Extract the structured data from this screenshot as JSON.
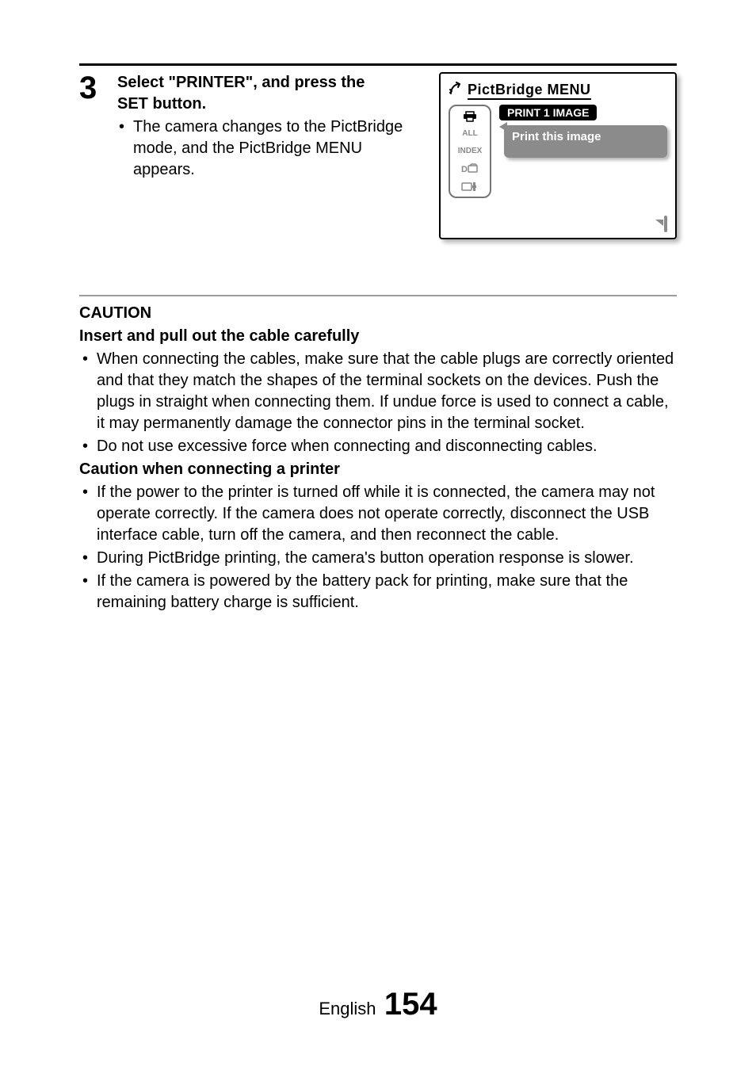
{
  "step": {
    "number": "3",
    "title_line1": "Select \"PRINTER\", and press the",
    "title_line2": "SET button.",
    "sub": "The camera changes to the PictBridge mode, and the PictBridge MENU appears."
  },
  "screen": {
    "title": "PictBridge MENU",
    "menu_highlight": "PRINT 1 IMAGE",
    "menu_note": "Print this image",
    "tabs": {
      "all": "ALL",
      "index": "INDEX",
      "d": "D"
    }
  },
  "caution": {
    "heading": "CAUTION",
    "sub1": "Insert and pull out the cable carefully",
    "b1": "When connecting the cables, make sure that the cable plugs are correctly oriented and that they match the shapes of the terminal sockets on the devices. Push the plugs in straight when connecting them. If undue force is used to connect a cable, it may permanently damage the connector pins in the terminal socket.",
    "b2": "Do not use excessive force when connecting and disconnecting cables.",
    "sub2": "Caution when connecting a printer",
    "b3": "If the power to the printer is turned off while it is connected, the camera may not operate correctly. If the camera does not operate correctly, disconnect the USB interface cable, turn off the camera, and then reconnect the cable.",
    "b4": "During PictBridge printing, the camera's button operation response is slower.",
    "b5": "If the camera is powered by the battery pack for printing, make sure that the remaining battery charge is sufficient."
  },
  "footer": {
    "label": "English",
    "page": "154"
  }
}
